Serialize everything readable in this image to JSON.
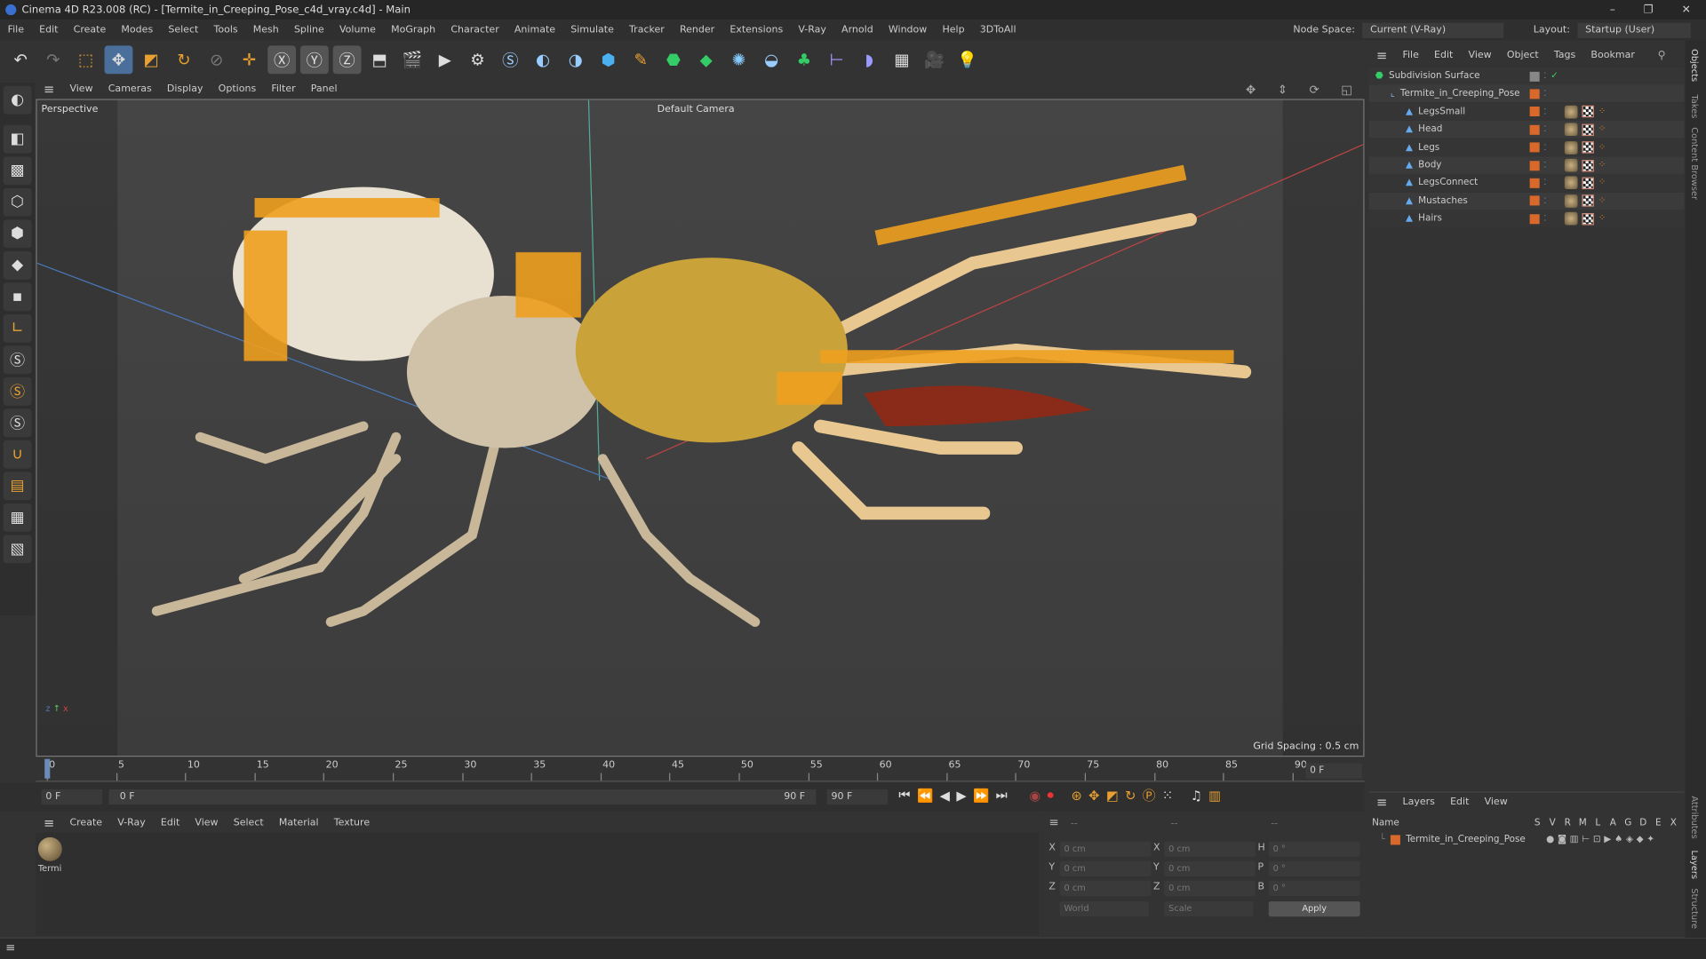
{
  "window": {
    "title": "Cinema 4D R23.008 (RC) - [Termite_in_Creeping_Pose_c4d_vray.c4d] - Main",
    "controls": [
      "–",
      "❐",
      "✕"
    ]
  },
  "menubar": {
    "items": [
      "File",
      "Edit",
      "Create",
      "Modes",
      "Select",
      "Tools",
      "Mesh",
      "Spline",
      "Volume",
      "MoGraph",
      "Character",
      "Animate",
      "Simulate",
      "Tracker",
      "Render",
      "Extensions",
      "V-Ray",
      "Arnold",
      "Window",
      "Help",
      "3DToAll"
    ],
    "node_space_label": "Node Space:",
    "node_space_value": "Current (V-Ray)",
    "layout_label": "Layout:",
    "layout_value": "Startup (User)"
  },
  "viewport": {
    "menu": [
      "View",
      "Cameras",
      "Display",
      "Options",
      "Filter",
      "Panel"
    ],
    "label": "Perspective",
    "camera": "Default Camera",
    "grid_spacing": "Grid Spacing : 0.5 cm"
  },
  "timeline": {
    "ticks": [
      "0",
      "5",
      "10",
      "15",
      "20",
      "25",
      "30",
      "35",
      "40",
      "45",
      "50",
      "55",
      "60",
      "65",
      "70",
      "75",
      "80",
      "85",
      "90"
    ],
    "current_frame": "0 F",
    "start": "0 F",
    "range_start": "0 F",
    "range_end": "90 F",
    "end": "90 F"
  },
  "materials": {
    "menu": [
      "Create",
      "V-Ray",
      "Edit",
      "View",
      "Select",
      "Material",
      "Texture"
    ],
    "items": [
      {
        "name": "Termi"
      }
    ]
  },
  "coords": {
    "headers": [
      "--",
      "--",
      "--"
    ],
    "rows": [
      {
        "a": "X",
        "av": "0 cm",
        "b": "X",
        "bv": "0 cm",
        "c": "H",
        "cv": "0 °"
      },
      {
        "a": "Y",
        "av": "0 cm",
        "b": "Y",
        "bv": "0 cm",
        "c": "P",
        "cv": "0 °"
      },
      {
        "a": "Z",
        "av": "0 cm",
        "b": "Z",
        "bv": "0 cm",
        "c": "B",
        "cv": "0 °"
      }
    ],
    "mode": "World",
    "type": "Scale",
    "apply": "Apply"
  },
  "objects": {
    "menu": [
      "File",
      "Edit",
      "View",
      "Object",
      "Tags",
      "Bookmar"
    ],
    "items": [
      {
        "name": "Subdivision Surface",
        "level": 0
      },
      {
        "name": "Termite_in_Creeping_Pose",
        "level": 1
      },
      {
        "name": "LegsSmall",
        "level": 2
      },
      {
        "name": "Head",
        "level": 2
      },
      {
        "name": "Legs",
        "level": 2
      },
      {
        "name": "Body",
        "level": 2
      },
      {
        "name": "LegsConnect",
        "level": 2
      },
      {
        "name": "Mustaches",
        "level": 2
      },
      {
        "name": "Hairs",
        "level": 2
      }
    ]
  },
  "layers": {
    "menu": [
      "Layers",
      "Edit",
      "View"
    ],
    "columns": [
      "Name",
      "S",
      "V",
      "R",
      "M",
      "L",
      "A",
      "G",
      "D",
      "E",
      "X"
    ],
    "items": [
      {
        "name": "Termite_in_Creeping_Pose",
        "color": "#d8692a"
      }
    ]
  },
  "side_tabs": {
    "top": [
      "Objects",
      "Takes",
      "Content Browser"
    ],
    "bottom": [
      "Attributes",
      "Layers",
      "Structure"
    ]
  },
  "colors": {
    "accent": "#d8692a",
    "bg": "#333333",
    "viewport": "#404040"
  }
}
